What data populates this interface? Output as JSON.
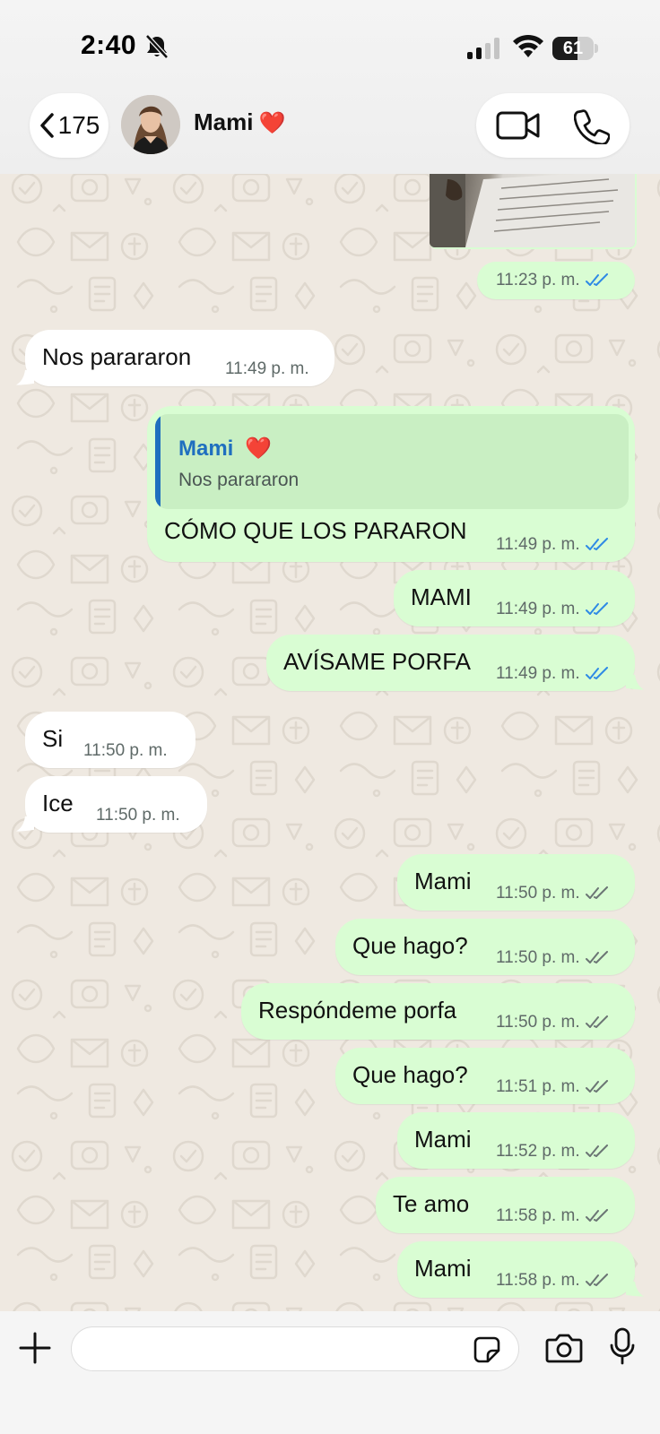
{
  "status_bar": {
    "time": "2:40",
    "battery": "61",
    "battery_level": 0.61
  },
  "header": {
    "back_count": "175",
    "contact_name": "Mami",
    "contact_emoji": "❤️"
  },
  "messages": [
    {
      "dir": "out",
      "kind": "photo_footer",
      "time": "11:23 p. m.",
      "status": "read"
    },
    {
      "dir": "in",
      "text": "Nos parararon",
      "time": "11:49 p. m."
    },
    {
      "dir": "out",
      "text": "CÓMO QUE LOS PARARON",
      "time": "11:49 p. m.",
      "status": "read",
      "reply_to": {
        "name": "Mami",
        "emoji": "❤️",
        "text": "Nos parararon"
      }
    },
    {
      "dir": "out",
      "text": "MAMI",
      "time": "11:49 p. m.",
      "status": "read"
    },
    {
      "dir": "out",
      "text": "AVÍSAME PORFA",
      "time": "11:49 p. m.",
      "status": "read"
    },
    {
      "dir": "in",
      "text": "Si",
      "time": "11:50 p. m."
    },
    {
      "dir": "in",
      "text": "Ice",
      "time": "11:50 p. m."
    },
    {
      "dir": "out",
      "text": "Mami",
      "time": "11:50 p. m.",
      "status": "delivered"
    },
    {
      "dir": "out",
      "text": "Que hago?",
      "time": "11:50 p. m.",
      "status": "delivered"
    },
    {
      "dir": "out",
      "text": "Respóndeme porfa",
      "time": "11:50 p. m.",
      "status": "delivered"
    },
    {
      "dir": "out",
      "text": "Que hago?",
      "time": "11:51 p. m.",
      "status": "delivered"
    },
    {
      "dir": "out",
      "text": "Mami",
      "time": "11:52 p. m.",
      "status": "delivered"
    },
    {
      "dir": "out",
      "text": "Te amo",
      "time": "11:58 p. m.",
      "status": "delivered"
    },
    {
      "dir": "out",
      "text": "Mami",
      "time": "11:58 p. m.",
      "status": "delivered"
    }
  ],
  "composer": {
    "value": "",
    "placeholder": ""
  },
  "colors": {
    "outgoing_bubble": "#d9fdd3",
    "incoming_bubble": "#ffffff",
    "read_ticks": "#2f8ae5",
    "delivered_ticks": "#6b7574",
    "reply_accent": "#1f6fbf"
  },
  "icons": [
    "bell-off-icon",
    "signal-icon",
    "wifi-icon",
    "battery-icon",
    "chevron-left-icon",
    "video-camera-icon",
    "phone-icon",
    "plus-icon",
    "sticker-icon",
    "camera-icon",
    "microphone-icon"
  ]
}
